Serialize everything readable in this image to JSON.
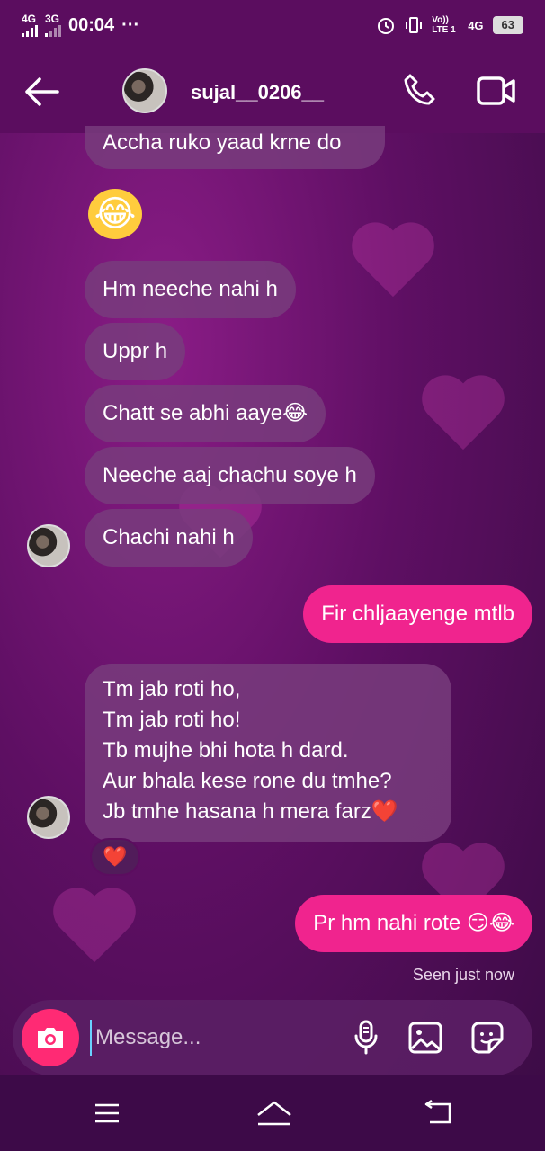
{
  "status_bar": {
    "net1": "4G",
    "net2": "3G",
    "time": "00:04",
    "dots": "···",
    "volte": "Vo)) LTE 1",
    "net3": "4G",
    "battery": "63"
  },
  "header": {
    "username": "sujal__0206__"
  },
  "messages": [
    {
      "text": "Accha ruko yaad krne do"
    },
    {
      "text": "😂"
    },
    {
      "text": "Hm neeche nahi h"
    },
    {
      "text": "Uppr h"
    },
    {
      "text": "Chatt se abhi aaye😂"
    },
    {
      "text": "Neeche aaj chachu soye h"
    },
    {
      "text": "Chachi nahi h"
    },
    {
      "text": "Fir chljaayenge mtlb"
    },
    {
      "text": "Tm jab roti ho,\nTm jab roti ho!\nTb mujhe bhi hota h dard.\nAur bhala kese rone du tmhe?\nJb tmhe hasana h mera farz❤️"
    },
    {
      "text": "Pr hm nahi rote 😏😂"
    }
  ],
  "reaction": "❤️",
  "seen": "Seen just now",
  "composer": {
    "placeholder": "Message..."
  }
}
